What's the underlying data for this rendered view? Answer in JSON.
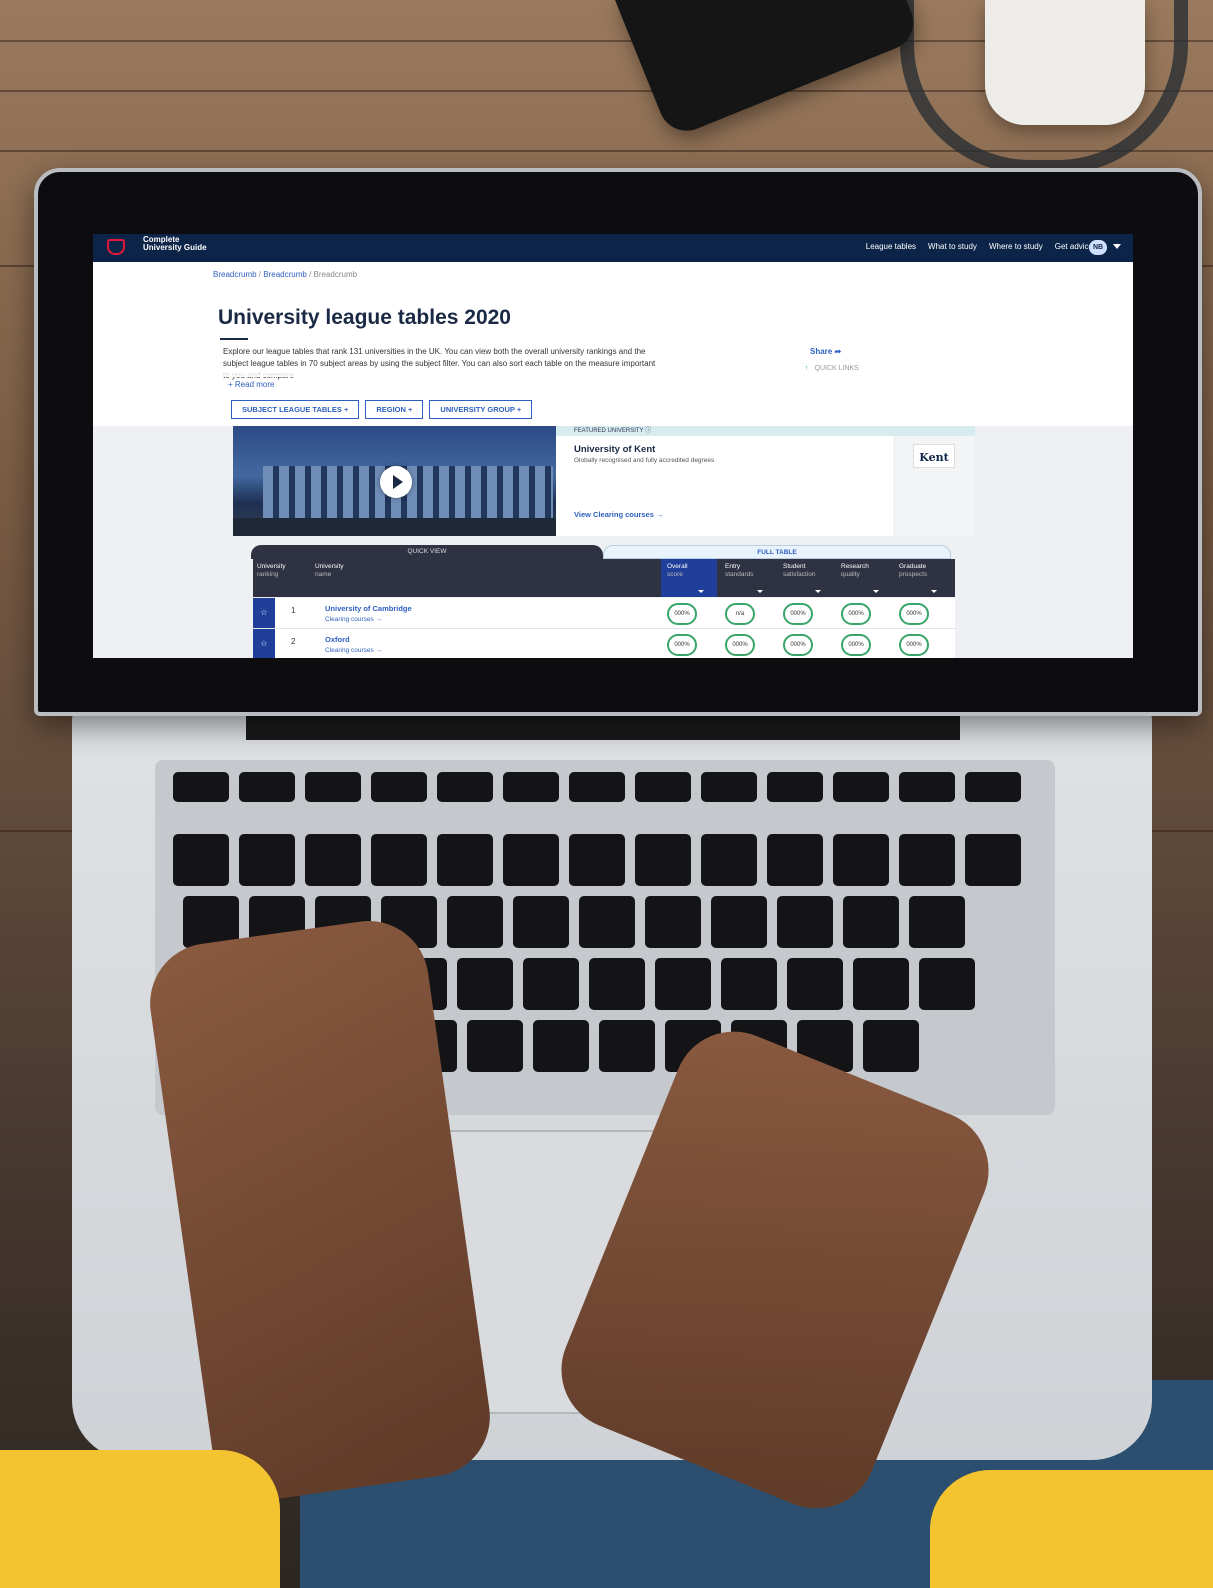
{
  "site": {
    "logo_text": "Complete University Guide",
    "nav": [
      "League tables",
      "What to study",
      "Where to study",
      "Get advice"
    ],
    "avatar_initials": "NB"
  },
  "breadcrumb": [
    "Breadcrumb",
    "Breadcrumb",
    "Breadcrumb"
  ],
  "page": {
    "title": "University league tables 2020",
    "intro": "Explore our league tables that rank 131 universities in the UK. You can view both the overall university rankings and the subject league tables in 70 subject areas by using the subject filter. You can also sort each table on the measure important to you and compare",
    "read_more": "+ Read more",
    "share": "Share",
    "quick_links": "QUICK LINKS"
  },
  "filters": [
    "SUBJECT LEAGUE TABLES +",
    "REGION +",
    "UNIVERSITY GROUP +"
  ],
  "featured": {
    "label": "FEATURED UNIVERSITY",
    "name": "University of Kent",
    "tagline": "Globally recognised and fully accredited degrees",
    "link": "View Clearing courses →",
    "logo_text": "Kent"
  },
  "tabs": {
    "quick": "QUICK VIEW",
    "full": "FULL TABLE"
  },
  "table": {
    "headers": [
      {
        "line1": "University",
        "line2": "ranking"
      },
      {
        "line1": "University",
        "line2": "name"
      },
      {
        "line1": "Overall",
        "line2": "score"
      },
      {
        "line1": "Entry",
        "line2": "standards"
      },
      {
        "line1": "Student",
        "line2": "satisfaction"
      },
      {
        "line1": "Research",
        "line2": "quality"
      },
      {
        "line1": "Graduate",
        "line2": "prospects"
      }
    ],
    "rows": [
      {
        "rank": "1",
        "name": "University of Cambridge",
        "link": "Clearing courses →",
        "scores": [
          "000%",
          "n/a",
          "000%",
          "000%",
          "000%"
        ]
      },
      {
        "rank": "2",
        "name": "Oxford",
        "link": "Clearing courses →",
        "scores": [
          "000%",
          "000%",
          "000%",
          "000%",
          "000%"
        ]
      }
    ]
  },
  "colors": {
    "navy": "#0d2449",
    "brand_red": "#e2173b",
    "link_blue": "#2d5fbf",
    "score_green": "#3aa56a"
  }
}
